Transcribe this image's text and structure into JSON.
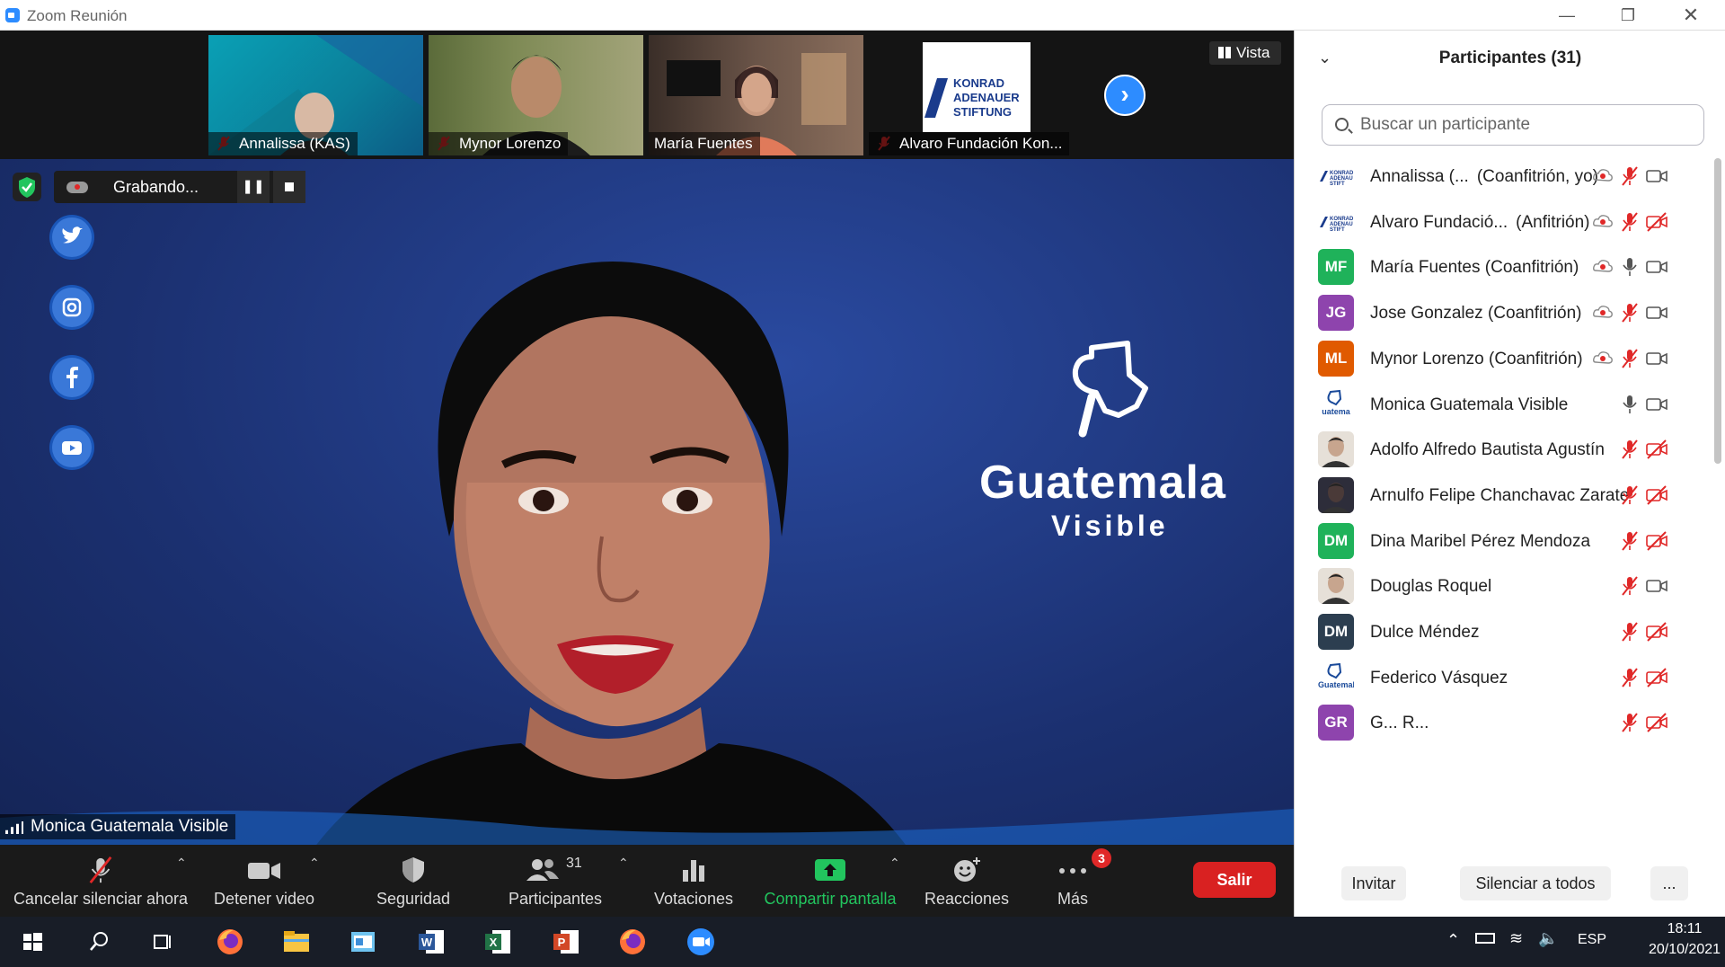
{
  "window": {
    "title": "Zoom Reunión"
  },
  "thumbnails": [
    {
      "name": "Annalissa (KAS)",
      "muted": true
    },
    {
      "name": "Mynor Lorenzo",
      "muted": true
    },
    {
      "name": "María Fuentes",
      "muted": false
    },
    {
      "name": "Alvaro Fundación Kon...",
      "muted": true,
      "logo": [
        "KONRAD",
        "ADENAUER",
        "STIFTUNG"
      ]
    }
  ],
  "view_button": {
    "label": "Vista"
  },
  "recording": {
    "label": "Grabando..."
  },
  "speaker": {
    "name": "Monica Guatemala Visible",
    "background_logo": {
      "line1": "Guatemala",
      "line2": "Visible"
    },
    "social_icons": [
      "twitter-icon",
      "instagram-icon",
      "facebook-icon",
      "youtube-icon"
    ]
  },
  "toolbar": {
    "mute_label": "Cancelar silenciar ahora",
    "video_label": "Detener video",
    "security_label": "Seguridad",
    "participants_label": "Participantes",
    "participants_count": "31",
    "polls_label": "Votaciones",
    "share_label": "Compartir pantalla",
    "reactions_label": "Reacciones",
    "more_label": "Más",
    "more_badge": "3",
    "leave_label": "Salir"
  },
  "panel": {
    "title": "Participantes (31)",
    "search_placeholder": "Buscar un participante",
    "invite_label": "Invitar",
    "mute_all_label": "Silenciar a todos",
    "more_label": "..."
  },
  "participants": [
    {
      "name": "Annalissa (...",
      "role": "(Coanfitrión, yo)",
      "avatar_type": "kas",
      "rec": true,
      "mic": "muted",
      "video": "on"
    },
    {
      "name": "Alvaro Fundació...",
      "role": "(Anfitrión)",
      "avatar_type": "kas",
      "rec": true,
      "mic": "muted",
      "video": "off"
    },
    {
      "name": "María Fuentes (Coanfitrión)",
      "role": "",
      "initials": "MF",
      "color": "#1fb25a",
      "rec": true,
      "mic": "on",
      "video": "on"
    },
    {
      "name": "Jose Gonzalez (Coanfitrión)",
      "role": "",
      "initials": "JG",
      "color": "#8e44ad",
      "rec": true,
      "mic": "muted",
      "video": "on"
    },
    {
      "name": "Mynor Lorenzo (Coanfitrión)",
      "role": "",
      "initials": "ML",
      "color": "#e05a00",
      "rec": true,
      "mic": "muted",
      "video": "on"
    },
    {
      "name": "Monica Guatemala Visible",
      "role": "",
      "avatar_type": "gv",
      "avatar_text": "uatema",
      "rec": false,
      "mic": "on",
      "video": "on"
    },
    {
      "name": "Adolfo Alfredo Bautista Agustín",
      "role": "",
      "avatar_type": "photo",
      "rec": false,
      "mic": "muted",
      "video": "off"
    },
    {
      "name": "Arnulfo Felipe Chanchavac Zarate",
      "role": "",
      "avatar_type": "photo2",
      "rec": false,
      "mic": "muted",
      "video": "off"
    },
    {
      "name": "Dina Maribel Pérez Mendoza",
      "role": "",
      "initials": "DM",
      "color": "#1fb25a",
      "rec": false,
      "mic": "muted",
      "video": "off"
    },
    {
      "name": "Douglas Roquel",
      "role": "",
      "avatar_type": "photo3",
      "rec": false,
      "mic": "muted",
      "video": "on"
    },
    {
      "name": "Dulce Méndez",
      "role": "",
      "initials": "DM",
      "color": "#2c3e50",
      "rec": false,
      "mic": "muted",
      "video": "off"
    },
    {
      "name": "Federico Vásquez",
      "role": "",
      "avatar_type": "gv",
      "avatar_text": "Guatemala",
      "rec": false,
      "mic": "muted",
      "video": "off"
    },
    {
      "name": "G... R...",
      "role": "",
      "initials": "GR",
      "color": "#8e44ad",
      "rec": false,
      "mic": "muted",
      "video": "off"
    }
  ],
  "taskbar": {
    "apps": [
      "windows-start-icon",
      "search-icon",
      "task-view-icon",
      "firefox-icon",
      "file-explorer-icon",
      "control-panel-icon",
      "word-icon",
      "excel-icon",
      "powerpoint-icon",
      "firefox-icon",
      "zoom-icon"
    ],
    "language": "ESP",
    "time": "18:11",
    "date": "20/10/2021"
  }
}
